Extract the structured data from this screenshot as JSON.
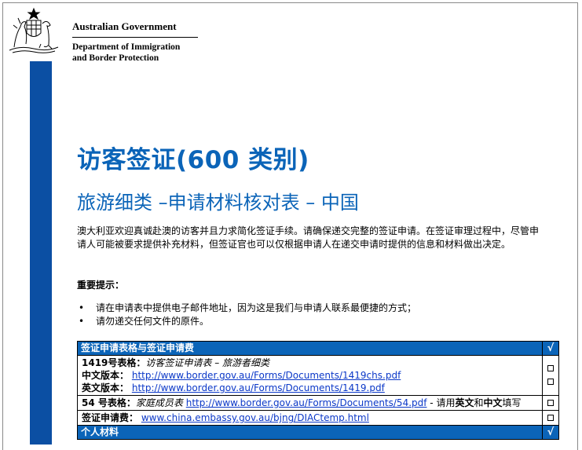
{
  "header": {
    "gov_name": "Australian Government",
    "department_line1": "Department of Immigration",
    "department_line2": "and Border Protection"
  },
  "title": "访客签证(600 类别)",
  "subtitle": "旅游细类 –申请材料核对表 – 中国",
  "intro": "澳大利亚欢迎真诚赴澳的访客并且力求简化签证手续。请确保递交完整的签证申请。在签证审理过程中，尽管申请人可能被要求提供补充材料，但签证官也可以仅根据申请人在递交申请时提供的信息和材料做出决定。",
  "notice": {
    "heading": "重要提示：",
    "bullets": [
      "请在申请表中提供电子邮件地址，因为这是我们与申请人联系最便捷的方式；",
      "请勿递交任何文件的原件。"
    ]
  },
  "checklist": {
    "section1": {
      "title": "签证申请表格与签证申请费",
      "tick": "√"
    },
    "form1419": {
      "label": "1419号表格：",
      "desc": "访客签证申请表 – 旅游者细类",
      "cn_label": "中文版本：",
      "cn_url": "http://www.border.gov.au/Forms/Documents/1419chs.pdf",
      "en_label": "英文版本：",
      "en_url": "http://www.border.gov.au/Forms/Documents/1419.pdf"
    },
    "form54": {
      "label": "54 号表格",
      "colon": "：",
      "desc": "家庭成员表",
      "url": "http://www.border.gov.au/Forms/Documents/54.pdf",
      "tail1": " - 请用",
      "en": "英文",
      "and": "和",
      "cn": "中文",
      "tail2": "填写"
    },
    "fee": {
      "label": "签证申请费：",
      "url": "www.china.embassy.gov.au/bjng/DIACtemp.html"
    },
    "section2": {
      "title": "个人材料",
      "tick": "√"
    }
  }
}
